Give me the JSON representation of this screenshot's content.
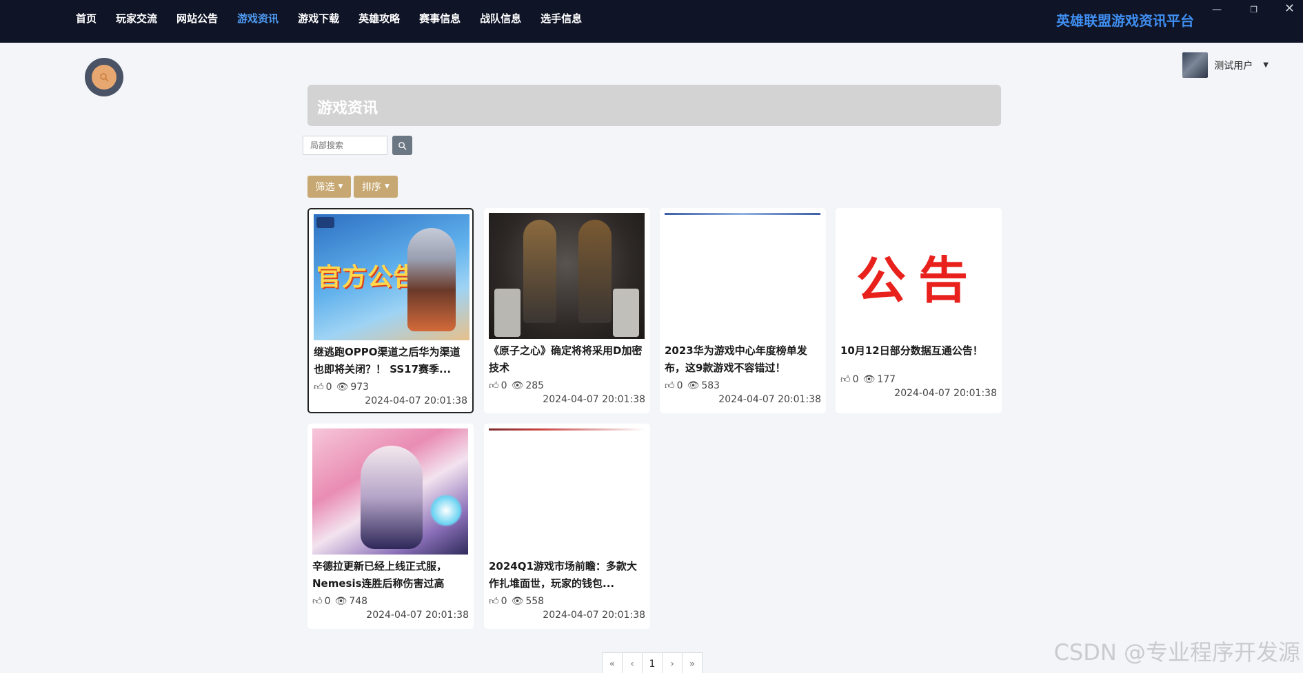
{
  "nav": {
    "items": [
      "首页",
      "玩家交流",
      "网站公告",
      "游戏资讯",
      "游戏下载",
      "英雄攻略",
      "赛事信息",
      "战队信息",
      "选手信息"
    ],
    "active_index": 3,
    "brand": "英雄联盟游戏资讯平台"
  },
  "window_controls": {
    "minimize": "—",
    "maximize": "❐",
    "close": "✕"
  },
  "user": {
    "name": "测试用户"
  },
  "page": {
    "title": "游戏资讯"
  },
  "search": {
    "placeholder": "局部搜索"
  },
  "filters": {
    "filter_label": "筛选",
    "sort_label": "排序"
  },
  "cards": [
    {
      "title": "继逃跑OPPO渠道之后华为渠道也即将关闭？！ SS17赛季...",
      "likes": "0",
      "views": "973",
      "date": "2024-04-07 20:01:38",
      "thumb_text": "官方公告"
    },
    {
      "title": "《原子之心》确定将将采用D加密技术",
      "likes": "0",
      "views": "285",
      "date": "2024-04-07 20:01:38"
    },
    {
      "title": "2023华为游戏中心年度榜单发布，这9款游戏不容错过！",
      "likes": "0",
      "views": "583",
      "date": "2024-04-07 20:01:38"
    },
    {
      "title": "10月12日部分数据互通公告！",
      "likes": "0",
      "views": "177",
      "date": "2024-04-07 20:01:38",
      "thumb_text": "公告"
    },
    {
      "title": "辛德拉更新已经上线正式服，Nemesis连胜后称伤害过高",
      "likes": "0",
      "views": "748",
      "date": "2024-04-07 20:01:38"
    },
    {
      "title": "2024Q1游戏市场前瞻：多款大作扎堆面世，玩家的钱包...",
      "likes": "0",
      "views": "558",
      "date": "2024-04-07 20:01:38"
    }
  ],
  "pagination": {
    "first": "«",
    "prev": "‹",
    "current": "1",
    "next": "›",
    "last": "»"
  },
  "watermark": "CSDN @专业程序开发源",
  "colors": {
    "nav_bg": "#0f1427",
    "nav_active": "#4f9df5",
    "brand": "#3f8ef0",
    "filter_btn": "#c7a872",
    "title_bar": "#d3d3d3"
  }
}
